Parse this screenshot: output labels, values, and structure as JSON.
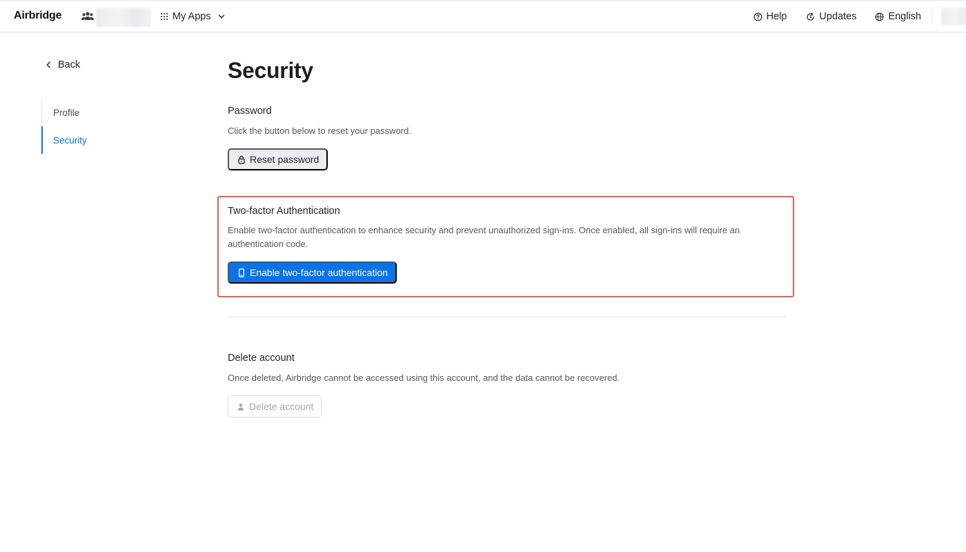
{
  "topbar": {
    "logo": "Airbridge",
    "apps_label": "My Apps",
    "help_label": "Help",
    "updates_label": "Updates",
    "language_label": "English"
  },
  "sidebar": {
    "back_label": "Back",
    "items": [
      {
        "label": "Profile",
        "active": false
      },
      {
        "label": "Security",
        "active": true
      }
    ]
  },
  "main": {
    "title": "Security",
    "password": {
      "title": "Password",
      "description": "Click the button below to reset your password.",
      "button_label": "Reset password"
    },
    "two_factor": {
      "title": "Two-factor Authentication",
      "description": "Enable two-factor authentication to enhance security and prevent unauthorized sign-ins. Once enabled, all sign-ins will require an authentication code.",
      "button_label": "Enable two-factor authentication"
    },
    "delete_account": {
      "title": "Delete account",
      "description": "Once deleted, Airbridge cannot be accessed using this account, and the data cannot be recovered.",
      "button_label": "Delete account",
      "disabled": true
    }
  },
  "colors": {
    "accent": "#0a73e8",
    "highlight": "#e0605a",
    "muted_button_bg": "#ebedf0"
  },
  "icons": {
    "team": "team-icon",
    "apps": "grid-icon",
    "help": "help-circle-icon",
    "updates": "refresh-icon",
    "language": "globe-icon",
    "back": "chevron-left-icon",
    "reset": "lock-icon",
    "two_factor": "phone-icon",
    "delete": "user-icon"
  }
}
